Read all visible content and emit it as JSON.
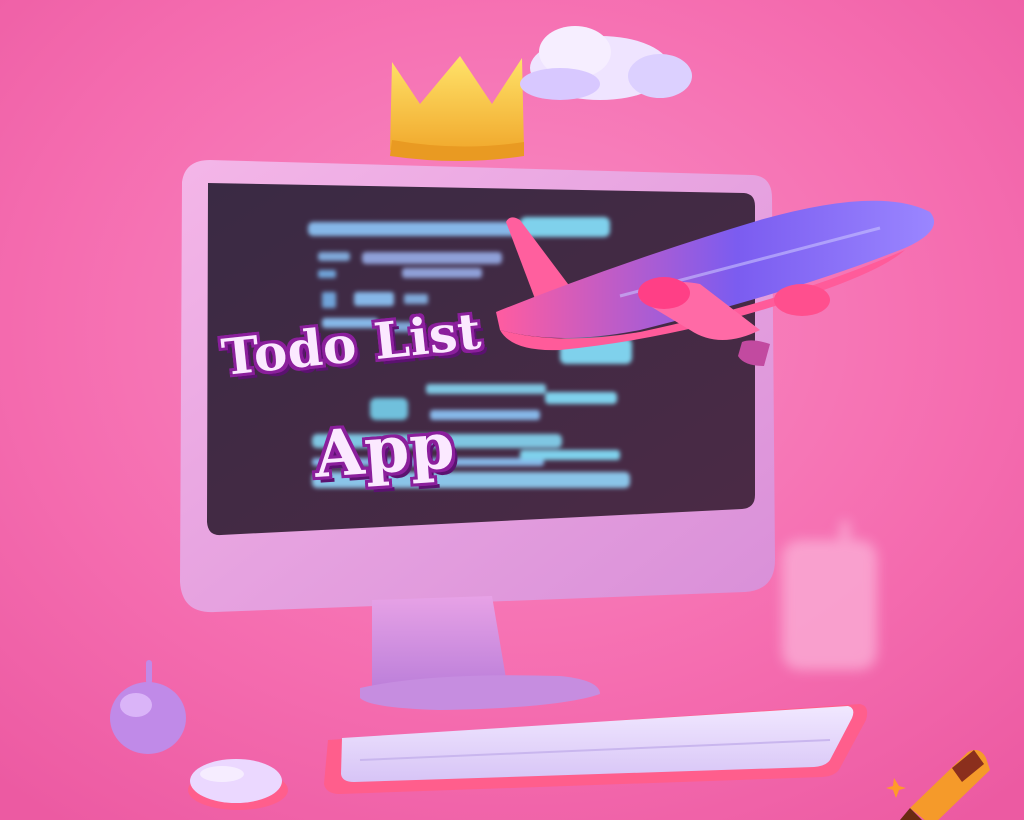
{
  "title": {
    "line1": "Todo List",
    "line2": "App"
  },
  "colors": {
    "background": "#f26aae",
    "title_fill": "#fbe9ff",
    "title_outline": "#8b1f9c"
  },
  "icons": {
    "crown": "crown-icon",
    "cloud": "cloud-icon",
    "airplane": "airplane-icon",
    "crayon": "crayon-icon"
  }
}
